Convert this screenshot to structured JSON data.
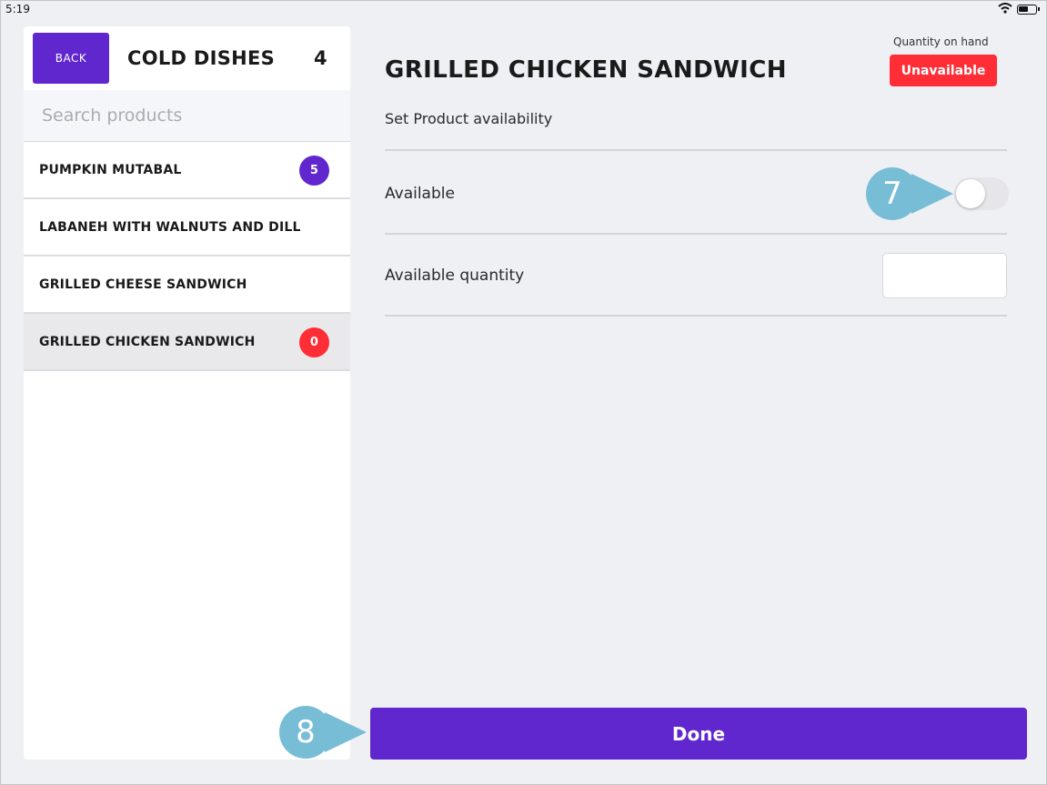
{
  "status_bar": {
    "time": "5:19"
  },
  "left_panel": {
    "back_label": "BACK",
    "category_title": "COLD DISHES",
    "category_count": "4",
    "search_placeholder": "Search products",
    "products": [
      {
        "name": "PUMPKIN MUTABAL",
        "badge": "5",
        "badge_color": "#5f27cd"
      },
      {
        "name": "LABANEH WITH WALNUTS AND DILL",
        "badge": ""
      },
      {
        "name": "GRILLED CHEESE SANDWICH",
        "badge": ""
      },
      {
        "name": "GRILLED CHICKEN SANDWICH",
        "badge": "0",
        "badge_color": "#ff2d36",
        "selected": true
      }
    ]
  },
  "detail": {
    "quantity_on_hand_label": "Quantity on hand",
    "status_badge": "Unavailable",
    "product_title": "GRILLED CHICKEN SANDWICH",
    "subtitle": "Set Product availability",
    "available_label": "Available",
    "available_toggle_on": false,
    "available_quantity_label": "Available quantity",
    "available_quantity_value": "",
    "done_label": "Done"
  },
  "callouts": {
    "step_toggle": "7",
    "step_done": "8"
  },
  "colors": {
    "accent": "#5f27cd",
    "danger": "#ff2d36",
    "callout": "#78bdd6"
  }
}
